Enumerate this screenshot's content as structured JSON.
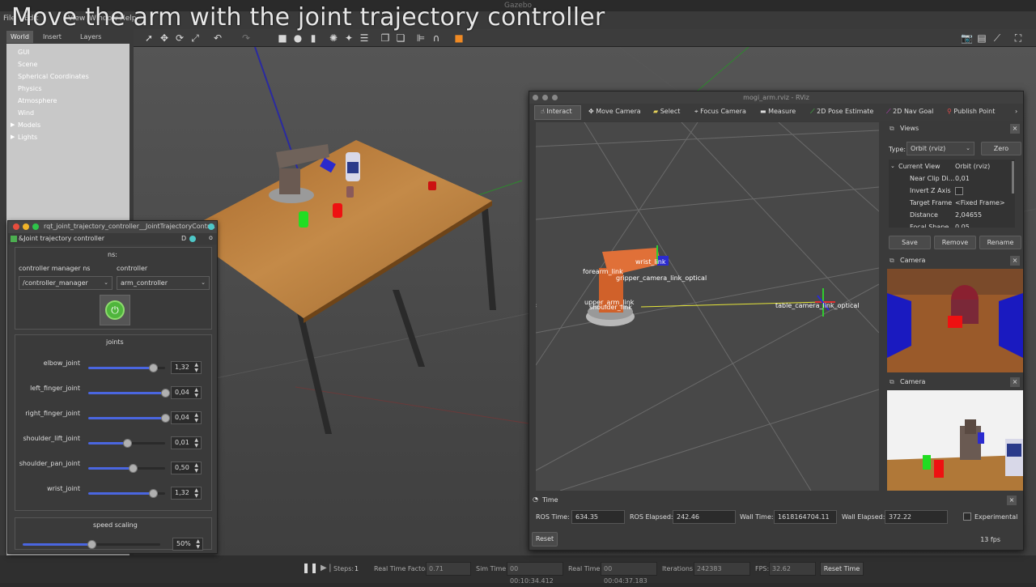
{
  "video_title": "Move the arm with the joint trajectory controller",
  "gazebo": {
    "window_title": "Gazebo",
    "menu": [
      "File",
      "Edit",
      "View",
      "Window",
      "Help"
    ],
    "tabs": [
      "World",
      "Insert",
      "Layers"
    ],
    "tree": [
      "GUI",
      "Scene",
      "Spherical Coordinates",
      "Physics",
      "Atmosphere",
      "Wind",
      "Models",
      "Lights"
    ],
    "bottom": {
      "steps_label": "Steps:",
      "steps_value": "1",
      "rtf_label": "Real Time Factor:",
      "rtf_value": "0.71",
      "sim_time_label": "Sim Time:",
      "sim_time_value": "00 00:10:34.412",
      "real_time_label": "Real Time:",
      "real_time_value": "00 00:04:37.183",
      "iterations_label": "Iterations:",
      "iterations_value": "242383",
      "fps_label": "FPS:",
      "fps_value": "32.62",
      "reset_time": "Reset Time"
    }
  },
  "rqt": {
    "window_title": "rqt_joint_trajectory_controller__JointTrajectoryContr...",
    "plugin_title": "&Joint trajectory controller",
    "plugin_buttons": "D",
    "ns_label": "ns:",
    "cm_ns_label": "controller manager ns",
    "controller_label": "controller",
    "cm_ns_value": "/controller_manager",
    "controller_value": "arm_controller",
    "joints_title": "joints",
    "joints": [
      {
        "name": "elbow_joint",
        "value": "1,32",
        "level": 0.84
      },
      {
        "name": "left_finger_joint",
        "value": "0,04",
        "level": 1.0
      },
      {
        "name": "right_finger_joint",
        "value": "0,04",
        "level": 1.0
      },
      {
        "name": "shoulder_lift_joint",
        "value": "0,01",
        "level": 0.5
      },
      {
        "name": "shoulder_pan_joint",
        "value": "0,50",
        "level": 0.58
      },
      {
        "name": "wrist_joint",
        "value": "1,32",
        "level": 0.84
      }
    ],
    "speed_title": "speed scaling",
    "speed_value": "50%",
    "speed_level": 0.5
  },
  "rviz": {
    "window_title": "mogi_arm.rviz - RViz",
    "tools": [
      "Interact",
      "Move Camera",
      "Select",
      "Focus Camera",
      "Measure",
      "2D Pose Estimate",
      "2D Nav Goal",
      "Publish Point"
    ],
    "scene_labels": {
      "forearm": "forearm_link",
      "wrist": "wrist_link",
      "gripper": "gripper_camera_link_optical",
      "upper_arm": "upper_arm_link",
      "shoulder": "shoulder_link",
      "table": "table_camera_link_optical"
    },
    "views": {
      "title": "Views",
      "type_label": "Type:",
      "type_value": "Orbit (rviz)",
      "zero": "Zero",
      "current_view": "Current View",
      "current_view_value": "Orbit (rviz)",
      "props": [
        {
          "name": "Near Clip Di...",
          "value": "0,01"
        },
        {
          "name": "Invert Z Axis",
          "value": ""
        },
        {
          "name": "Target Frame",
          "value": "<Fixed Frame>"
        },
        {
          "name": "Distance",
          "value": "2,04655"
        },
        {
          "name": "Focal Shape ...",
          "value": "0,05"
        }
      ],
      "save": "Save",
      "remove": "Remove",
      "rename": "Rename"
    },
    "camera1_title": "Camera",
    "camera2_title": "Camera",
    "time": {
      "title": "Time",
      "ros_time_label": "ROS Time:",
      "ros_time": "634.35",
      "ros_elapsed_label": "ROS Elapsed:",
      "ros_elapsed": "242.46",
      "wall_time_label": "Wall Time:",
      "wall_time": "1618164704.11",
      "wall_elapsed_label": "Wall Elapsed:",
      "wall_elapsed": "372.22",
      "experimental": "Experimental"
    },
    "reset": "Reset",
    "fps": "13 fps"
  }
}
